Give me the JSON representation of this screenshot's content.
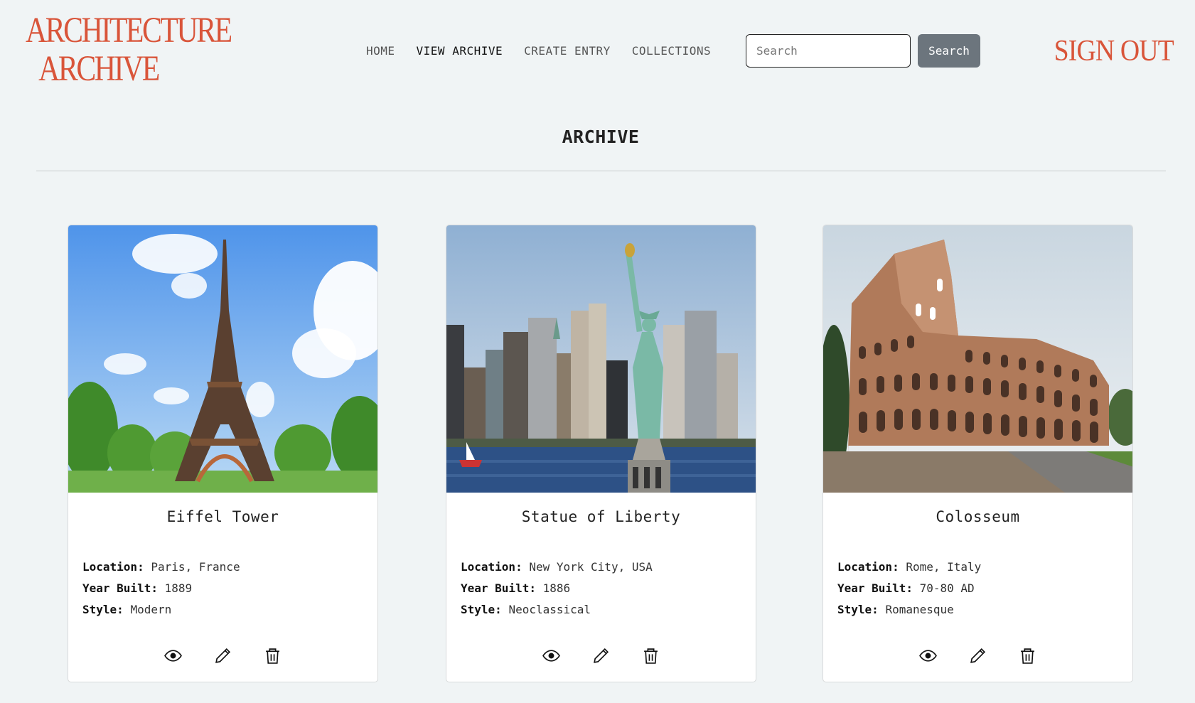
{
  "brand": {
    "line1": "ARCHITECTURE",
    "line2": "ARCHIVE",
    "accent_color": "#d9553a"
  },
  "nav": [
    {
      "label": "HOME",
      "active": false
    },
    {
      "label": "VIEW ARCHIVE",
      "active": true
    },
    {
      "label": "CREATE ENTRY",
      "active": false
    },
    {
      "label": "COLLECTIONS",
      "active": false
    }
  ],
  "search": {
    "placeholder": "Search",
    "value": "",
    "button_label": "Search"
  },
  "sign_out_label": "SIGN OUT",
  "page_title": "ARCHIVE",
  "labels": {
    "location": "Location:",
    "year_built": "Year Built:",
    "style": "Style:"
  },
  "cards": [
    {
      "title": "Eiffel Tower",
      "location": "Paris, France",
      "year_built": "1889",
      "style": "Modern",
      "image": "eiffel-tower-photo"
    },
    {
      "title": "Statue of Liberty",
      "location": "New York City, USA",
      "year_built": "1886",
      "style": "Neoclassical",
      "image": "statue-of-liberty-photo"
    },
    {
      "title": "Colosseum",
      "location": "Rome, Italy",
      "year_built": "70-80 AD",
      "style": "Romanesque",
      "image": "colosseum-photo"
    }
  ],
  "card_actions": [
    "eye-icon",
    "pencil-icon",
    "trash-icon"
  ]
}
